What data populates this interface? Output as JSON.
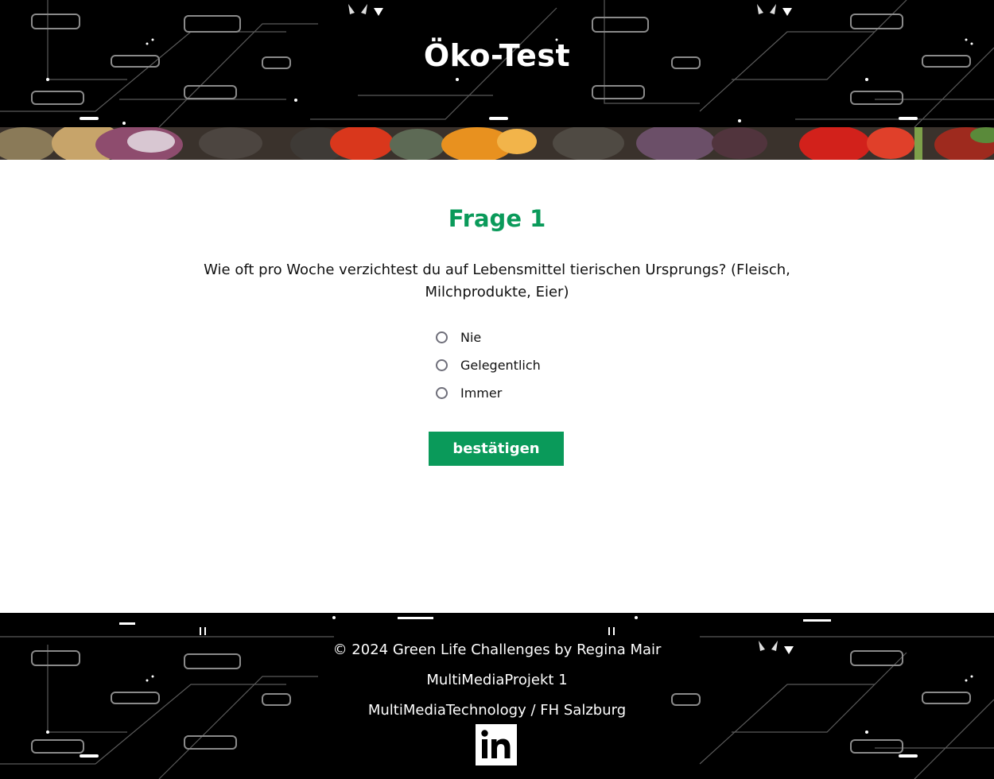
{
  "header": {
    "title": "Öko-Test"
  },
  "quiz": {
    "question_title": "Frage 1",
    "question_text": "Wie oft pro Woche verzichtest du auf Lebensmittel tierischen Ursprungs? (Fleisch, Milchprodukte, Eier)",
    "options": [
      {
        "label": "Nie",
        "selected": false
      },
      {
        "label": "Gelegentlich",
        "selected": false
      },
      {
        "label": "Immer",
        "selected": false
      }
    ],
    "submit_label": "bestätigen"
  },
  "footer": {
    "copyright": "© 2024 Green Life Challenges by Regina Mair",
    "project": "MultiMediaProjekt 1",
    "institution": "MultiMediaTechnology / FH Salzburg",
    "social_icon": "linkedin-icon"
  },
  "colors": {
    "accent": "#0a9a5a",
    "header_bg": "#000000",
    "text": "#111111"
  }
}
